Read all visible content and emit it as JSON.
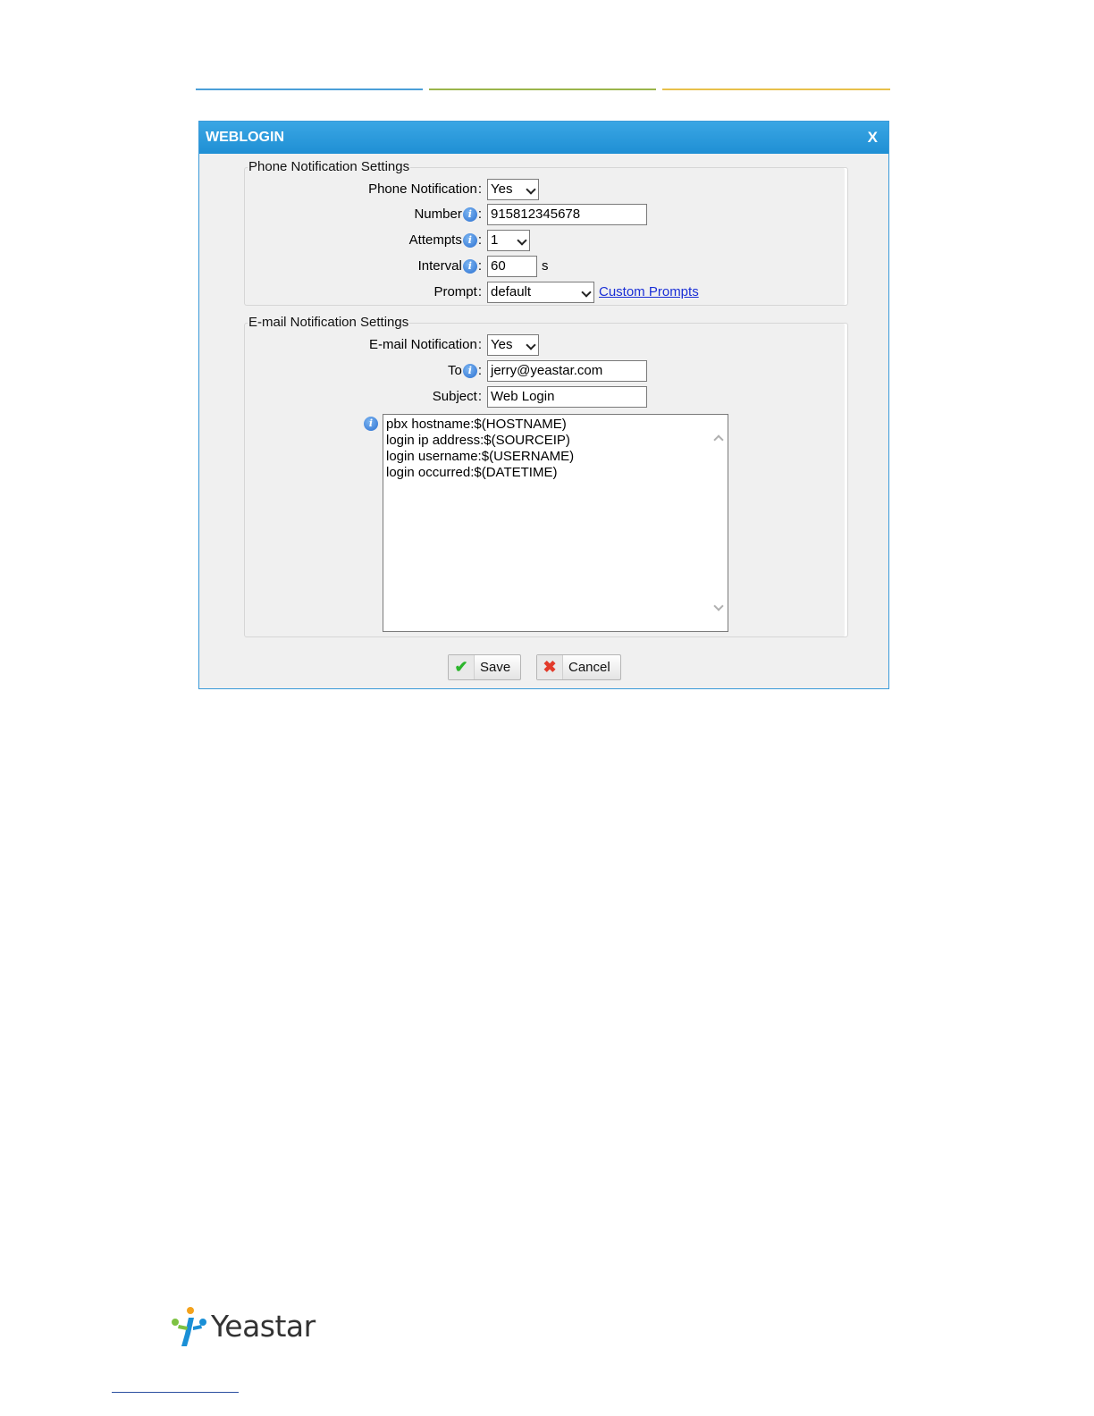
{
  "dialog": {
    "title": "WEBLOGIN",
    "close_label": "X"
  },
  "phone_settings": {
    "legend": "Phone Notification Settings",
    "phone_notification": {
      "label": "Phone Notification",
      "value": "Yes"
    },
    "number": {
      "label": "Number",
      "value": "915812345678"
    },
    "attempts": {
      "label": "Attempts",
      "value": "1"
    },
    "interval": {
      "label": "Interval",
      "value": "60",
      "unit": "s"
    },
    "prompt": {
      "label": "Prompt",
      "value": "default",
      "link": "Custom Prompts"
    }
  },
  "email_settings": {
    "legend": "E-mail Notification Settings",
    "email_notification": {
      "label": "E-mail Notification",
      "value": "Yes"
    },
    "to": {
      "label": "To",
      "value": "jerry@yeastar.com"
    },
    "subject": {
      "label": "Subject",
      "value": "Web Login"
    },
    "body_lines": [
      "pbx hostname:$(HOSTNAME)",
      "login ip address:$(SOURCEIP)",
      "login username:$(USERNAME)",
      "login occurred:$(DATETIME)"
    ]
  },
  "buttons": {
    "save": "Save",
    "cancel": "Cancel"
  },
  "footer": {
    "logo_text": "Yeastar"
  },
  "colors": {
    "title_bar": "#1f8fd4",
    "link": "#1a2fd6"
  },
  "icons": {
    "info": "info-icon",
    "save": "check-icon",
    "cancel": "x-icon"
  }
}
